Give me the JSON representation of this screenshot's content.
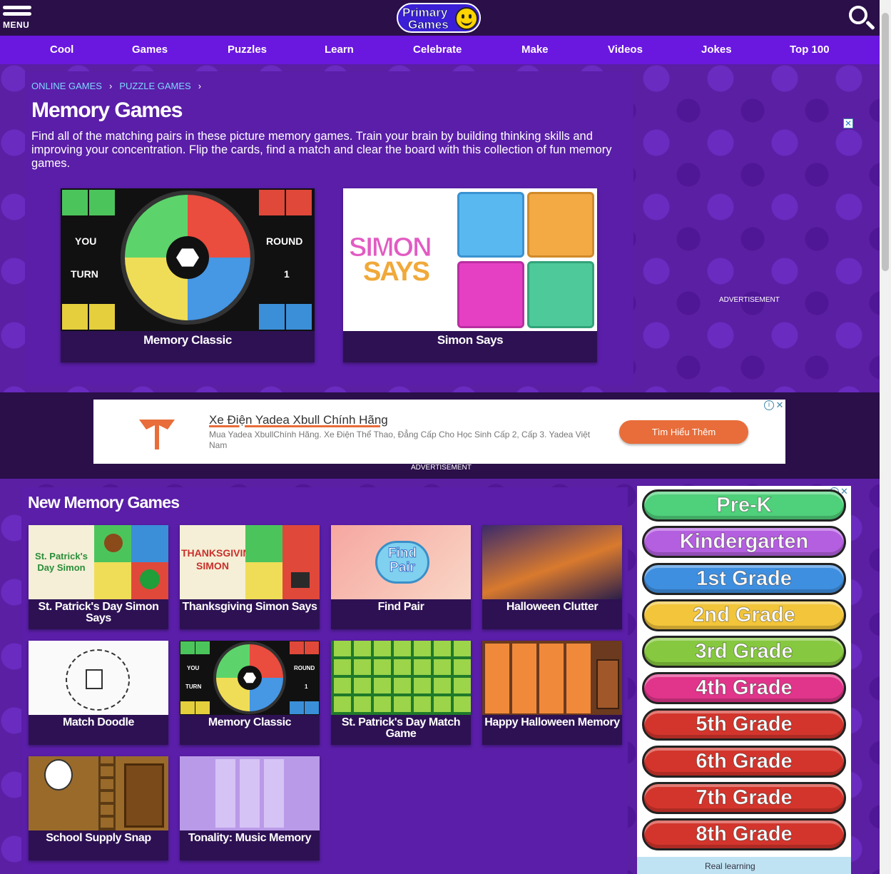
{
  "header": {
    "menu_label": "MENU",
    "logo_line1": "Primary",
    "logo_line2": "Games"
  },
  "nav": [
    "Cool",
    "Games",
    "Puzzles",
    "Learn",
    "Celebrate",
    "Make",
    "Videos",
    "Jokes",
    "Top 100"
  ],
  "breadcrumb": {
    "items": [
      "ONLINE GAMES",
      "PUZZLE GAMES"
    ],
    "separator": "›"
  },
  "page": {
    "title": "Memory Games",
    "description": "Find all of the matching pairs in these picture memory games. Train your brain by building thinking skills and improving your concentration. Flip the cards, find a match and clear the board with this collection of fun memory games."
  },
  "featured": [
    {
      "title": "Memory Classic",
      "thumb_text": {
        "left_top": "YOU",
        "left_bottom": "TURN",
        "right_top": "ROUND",
        "right_bottom": "1"
      }
    },
    {
      "title": "Simon Says",
      "thumb_text": {
        "line1": "SIMON",
        "line2": "SAYS"
      }
    }
  ],
  "right_ad": {
    "close": "✕",
    "label": "ADVERTISEMENT"
  },
  "banner_ad": {
    "headline": "Xe Điện Yadea Xbull Chính Hãng",
    "body": "Mua Yadea XbullChính Hãng. Xe Điện Thể Thao, Đẳng Cấp Cho Học Sinh Cấp 2, Cấp 3. Yadea Việt Nam",
    "button": "Tìm Hiểu Thêm",
    "info": "i",
    "close": "✕",
    "label": "ADVERTISEMENT"
  },
  "new_section": {
    "heading": "New Memory Games",
    "games": [
      {
        "title": "St. Patrick's Day Simon Says",
        "thumb_text": "St. Patrick's Day Simon"
      },
      {
        "title": "Thanksgiving Simon Says",
        "thumb_text": "THANKSGIVING SIMON"
      },
      {
        "title": "Find Pair",
        "thumb_text": "Find Pair"
      },
      {
        "title": "Halloween Clutter"
      },
      {
        "title": "Match Doodle"
      },
      {
        "title": "Memory Classic",
        "thumb_text": {
          "left_top": "YOU",
          "left_bottom": "TURN",
          "right_top": "ROUND",
          "right_bottom": "1"
        }
      },
      {
        "title": "St. Patrick's Day Match Game"
      },
      {
        "title": "Happy Halloween Memory"
      },
      {
        "title": "School Supply Snap"
      },
      {
        "title": "Tonality: Music Memory"
      }
    ]
  },
  "grades_ad": {
    "info": "i",
    "close": "✕",
    "items": [
      {
        "label": "Pre-K",
        "color": "#4fd07a"
      },
      {
        "label": "Kindergarten",
        "color": "#b45ee0"
      },
      {
        "label": "1st Grade",
        "color": "#3f8fe0"
      },
      {
        "label": "2nd Grade",
        "color": "#f2c53a"
      },
      {
        "label": "3rd Grade",
        "color": "#86c83f"
      },
      {
        "label": "4th Grade",
        "color": "#e0358a"
      },
      {
        "label": "5th Grade",
        "color": "#d3352c"
      },
      {
        "label": "6th Grade",
        "color": "#d3352c"
      },
      {
        "label": "7th Grade",
        "color": "#d3352c"
      },
      {
        "label": "8th Grade",
        "color": "#d3352c"
      }
    ],
    "promo": "Real learning"
  },
  "colors": {
    "topbar": "#2a0f49",
    "nav": "#6a17e0",
    "background": "#5a1fa3",
    "card_caption": "#2d1153",
    "link": "#7fd6ff",
    "ad_button": "#e86d3a"
  }
}
